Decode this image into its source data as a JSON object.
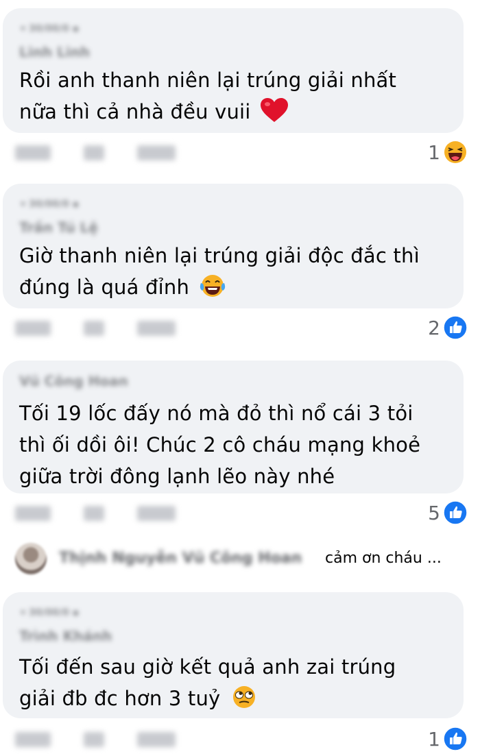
{
  "comments": [
    {
      "meta": "▾ 30/00/0 ▪",
      "author": "Linh Linh",
      "text_lines": [
        "Rồi anh thanh niên lại trúng giải nhất",
        "nữa thì cả nhà đều vuii"
      ],
      "reaction_count": "1",
      "reaction_icon": "haha-icon"
    },
    {
      "meta": "▾ 30/00/0 ▪",
      "author": "Trần Tú Lệ",
      "text_lines": [
        "Giờ thanh niên lại trúng giải độc đắc thì",
        "đúng là quá đỉnh"
      ],
      "reaction_count": "2",
      "reaction_icon": "like-icon"
    },
    {
      "author": "Vũ Công Hoan",
      "text_lines": [
        "Tối 19 lốc đấy nó mà đỏ thì nổ cái 3 tỏi",
        "thì ối dồi ôi! Chúc 2 cô cháu mạng khoẻ",
        "giữa trời đông lạnh lẽo này nhé"
      ],
      "reaction_count": "5",
      "reaction_icon": "like-icon"
    },
    {
      "meta": "▾ 30/00/0 ▪",
      "author": "Trình Khánh",
      "text_lines": [
        "Tối đến sau giờ kết quả anh zai trúng",
        "giải đb đc hơn 3 tuỷ"
      ],
      "reaction_count": "1",
      "reaction_icon": "like-icon"
    }
  ],
  "reply": {
    "names": "Thịnh Nguyễn  Vũ Công Hoan",
    "text": "cảm ơn cháu ..."
  },
  "actions": [
    "2:40",
    "Thích",
    "Trả lời"
  ],
  "colors": {
    "bubble": "#f0f2f5",
    "like": "#1877f2",
    "text": "#050505",
    "muted": "#65676b"
  }
}
